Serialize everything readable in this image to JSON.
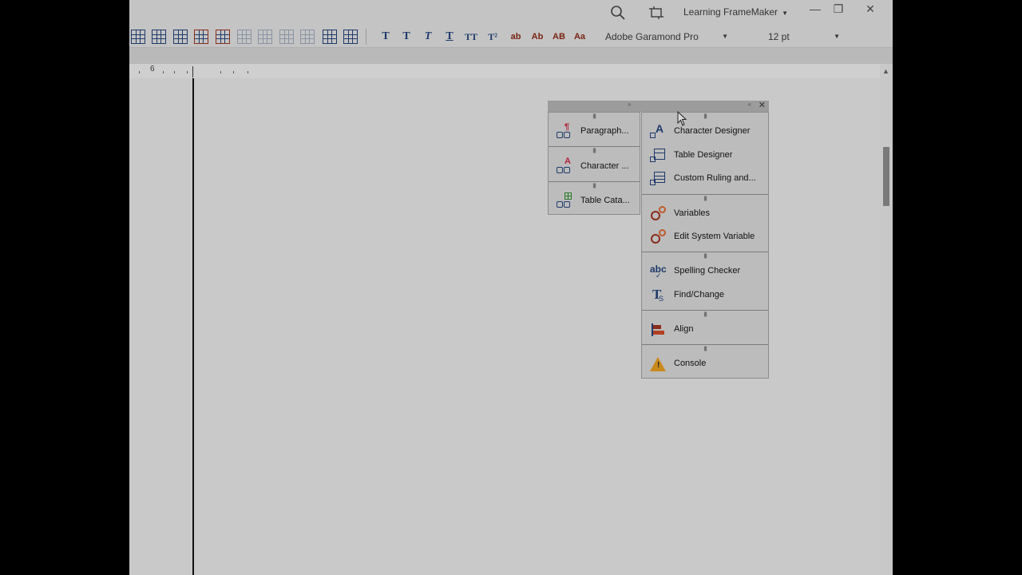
{
  "window": {
    "workspace_label": "Learning FrameMaker",
    "minimize": "—",
    "restore": "❐",
    "close": "✕"
  },
  "toolbar": {
    "format_buttons": [
      "T",
      "T",
      "T",
      "T",
      "TT",
      "T²",
      "ab",
      "Ab",
      "AB",
      "Aa"
    ],
    "font_family": "Adobe Garamond Pro",
    "font_size": "12 pt"
  },
  "ruler": {
    "marker_number": "6"
  },
  "panel": {
    "left_items": [
      {
        "label": "Paragraph..."
      },
      {
        "label": "Character ..."
      },
      {
        "label": "Table Cata..."
      }
    ],
    "right_groups": [
      [
        "Character Designer",
        "Table Designer",
        "Custom Ruling and..."
      ],
      [
        "Variables",
        "Edit System Variable"
      ],
      [
        "Spelling Checker",
        "Find/Change"
      ],
      [
        "Align"
      ],
      [
        "Console"
      ]
    ],
    "grip": "||||||"
  },
  "icons": {
    "search": "search-icon",
    "crop": "crop-icon",
    "brand_accent": "#1e3a6b",
    "warm_accent": "#8a2d1a"
  }
}
